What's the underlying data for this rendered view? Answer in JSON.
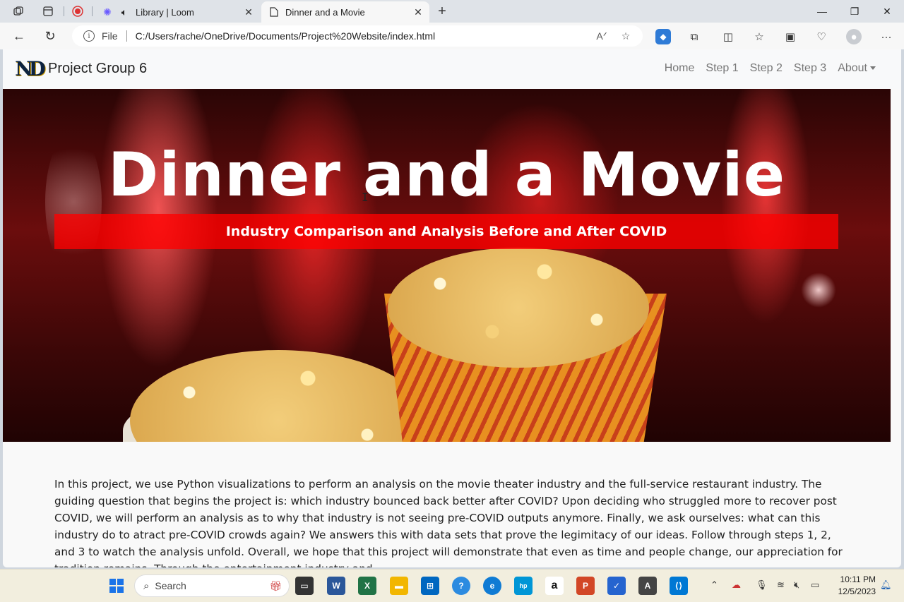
{
  "browser": {
    "tabs": [
      {
        "title": "Library | Loom",
        "active": false
      },
      {
        "title": "Dinner and a Movie",
        "active": true
      }
    ],
    "address": {
      "scheme_label": "File",
      "url": "C:/Users/rache/OneDrive/Documents/Project%20Website/index.html"
    }
  },
  "site": {
    "brand": "Project Group 6",
    "logo_text": "ND",
    "nav": [
      "Home",
      "Step 1",
      "Step 2",
      "Step 3",
      "About"
    ],
    "hero": {
      "title": "Dinner and a Movie",
      "subtitle": "Industry Comparison and Analysis Before and After COVID"
    },
    "intro": "In this project, we use Python visualizations to perform an analysis on the movie theater industry and the full-service restaurant industry. The guiding question that begins the project is: which industry bounced back better after COVID? Upon deciding who struggled more to recover post COVID, we will perform an analysis as to why that industry is not seeing pre-COVID outputs anymore. Finally, we ask ourselves: what can this industry do to atract pre-COVID crowds again? We answers this with data sets that prove the legimitacy of our ideas. Follow through steps 1, 2, and 3 to watch the analysis unfold. Overall, we hope that this project will demonstrate that even as time and people change, our appreciation for tradition remains. Through the entertainment industry and"
  },
  "taskbar": {
    "search_label": "Search",
    "time": "10:11 PM",
    "date": "12/5/2023"
  },
  "colors": {
    "accent_red": "#ff0000",
    "nd_navy": "#0c2340",
    "nd_gold": "#c99700"
  }
}
